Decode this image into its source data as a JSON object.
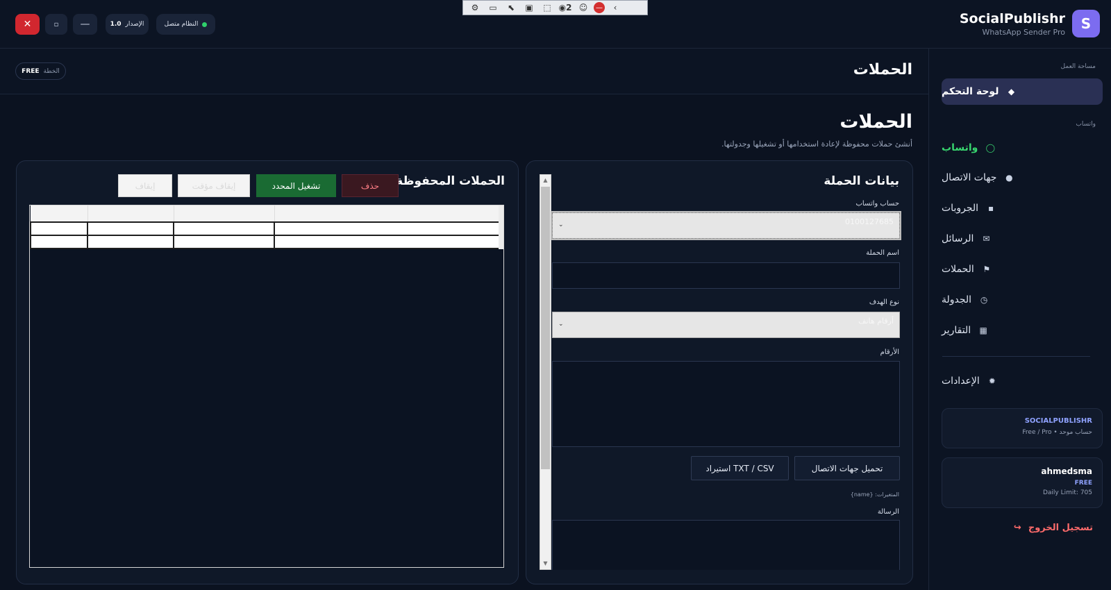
{
  "topbar": {
    "brand_name": "SocialPublishr",
    "brand_sub": "WhatsApp Sender Pro",
    "brand_logo": "S",
    "version_label": "الإصدار",
    "version_value": "1.0",
    "status_text": "النظام متصل",
    "close_glyph": "✕",
    "max_glyph": "▫",
    "min_glyph": "—",
    "toolbar_counter": "2"
  },
  "header": {
    "title": "الحملات",
    "plan_label": "الخطة",
    "plan_value": "FREE"
  },
  "sidebar": {
    "section_workspace": "مساحة العمل",
    "section_whatsapp": "واتساب",
    "items": [
      {
        "label": "لوحة التحكم",
        "icon": "◆"
      },
      {
        "label": "واتساب",
        "icon": "◯"
      },
      {
        "label": "جهات الاتصال",
        "icon": "●"
      },
      {
        "label": "الجروبات",
        "icon": "▪"
      },
      {
        "label": "الرسائل",
        "icon": "✉"
      },
      {
        "label": "الحملات",
        "icon": "⚑"
      },
      {
        "label": "الجدولة",
        "icon": "◷"
      },
      {
        "label": "التقارير",
        "icon": "▦"
      },
      {
        "label": "الإعدادات",
        "icon": "✹"
      }
    ],
    "account_card": {
      "title": "SOCIALPUBLISHR",
      "sub": "حساب موحد • Free / Pro"
    },
    "user_card": {
      "name": "ahmedsma",
      "plan": "FREE",
      "limit": "Daily Limit: 705"
    },
    "logout": "تسجيل الخروج",
    "logout_icon": "↪"
  },
  "page": {
    "heading": "الحملات",
    "description": "أنشئ حملات محفوظة لإعادة استخدامها أو تشغيلها وجدولتها."
  },
  "form": {
    "title": "بيانات الحملة",
    "account_label": "حساب واتساب",
    "account_value": "0100127685",
    "name_label": "اسم الحملة",
    "name_value": "",
    "target_label": "نوع الهدف",
    "target_value": "أرقام هاتف",
    "numbers_label": "الأرقام",
    "load_contacts_btn": "تحميل جهات الاتصال",
    "import_btn": "استيراد TXT / CSV",
    "vars_note": "المتغيرات: {name}",
    "message_label": "الرسالة"
  },
  "saved": {
    "title": "الحملات المحفوظة",
    "delete_btn": "حذف",
    "run_btn": "تشغيل المحدد",
    "pause_btn": "إيقاف مؤقت",
    "stop_btn": "إيقاف"
  },
  "colors": {
    "accent": "#7c6cf0",
    "success": "#2fd06b",
    "danger": "#d1272f",
    "run_green": "#1a6b33"
  }
}
